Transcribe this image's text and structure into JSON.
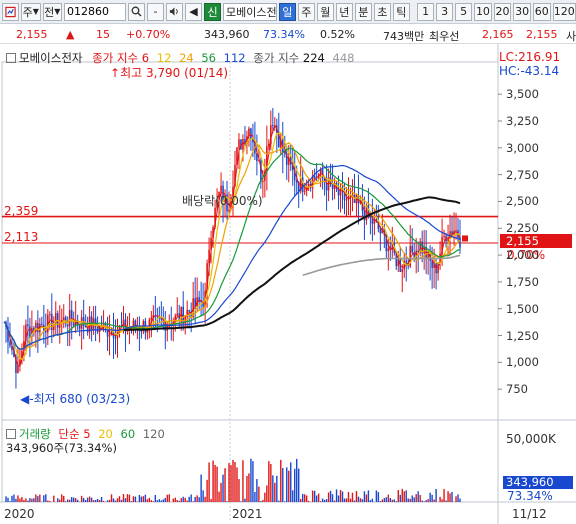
{
  "toolbar": {
    "menu_icon": "chart-icon",
    "type_label": "주",
    "type2_label": "전",
    "code_value": "012860",
    "search_icon": "search-icon",
    "minus_label": "-",
    "sound_icon": "speaker-icon",
    "prev_icon": "arrow-left-icon",
    "credit_label": "신",
    "stock_name": "모베이스전",
    "period_buttons": [
      "일",
      "주",
      "월",
      "년",
      "분",
      "초",
      "틱"
    ],
    "interval_buttons": [
      "1",
      "3",
      "5",
      "10",
      "20",
      "30",
      "60",
      "120"
    ]
  },
  "quote": {
    "price": "2,155",
    "change_arrow": "▲",
    "change": "15",
    "change_pct": "+0.70%",
    "volume": "343,960",
    "volume_ratio": "73.34%",
    "turnover": "0.52%",
    "amount": "743백만",
    "preferred_label": "최우선",
    "ask": "2,165",
    "bid": "2,155",
    "extra": "사"
  },
  "chart_data": {
    "type": "candlestick",
    "name": "모베이스전자",
    "legend": {
      "close_label": "종가 지수",
      "ma": [
        "6",
        "12",
        "24",
        "56",
        "112"
      ],
      "close_label2": "종가 지수",
      "ma2": [
        "224",
        "448"
      ]
    },
    "high_label": "최고 3,790 (01/14)",
    "low_label": "최저 680 (03/23)",
    "dividend_label": "배당락(0.00%)",
    "lines": [
      {
        "label": "2,359",
        "value": 2359
      },
      {
        "label": "2,113",
        "value": 2113
      }
    ],
    "lc_label": "LC:216.91",
    "hc_label": "HC:-43.14",
    "current_price_label": "2,155",
    "current_pct_label": "0.70%",
    "y_ticks": [
      "3,500",
      "3,250",
      "3,000",
      "2,750",
      "2,500",
      "2,250",
      "2,000",
      "1,750",
      "1,500",
      "1,250",
      "1,000",
      "750"
    ],
    "ylim": [
      500,
      3800
    ],
    "x_labels": [
      "2020",
      "2021",
      "11/12"
    ],
    "volume": {
      "title": "거래량",
      "ma_title": "단순",
      "ma": [
        "5",
        "20",
        "60",
        "120"
      ],
      "value_label": "343,960주(73.34%)",
      "y_tick": "50,000K",
      "current_label": "343,960",
      "current_pct": "73.34%"
    }
  }
}
